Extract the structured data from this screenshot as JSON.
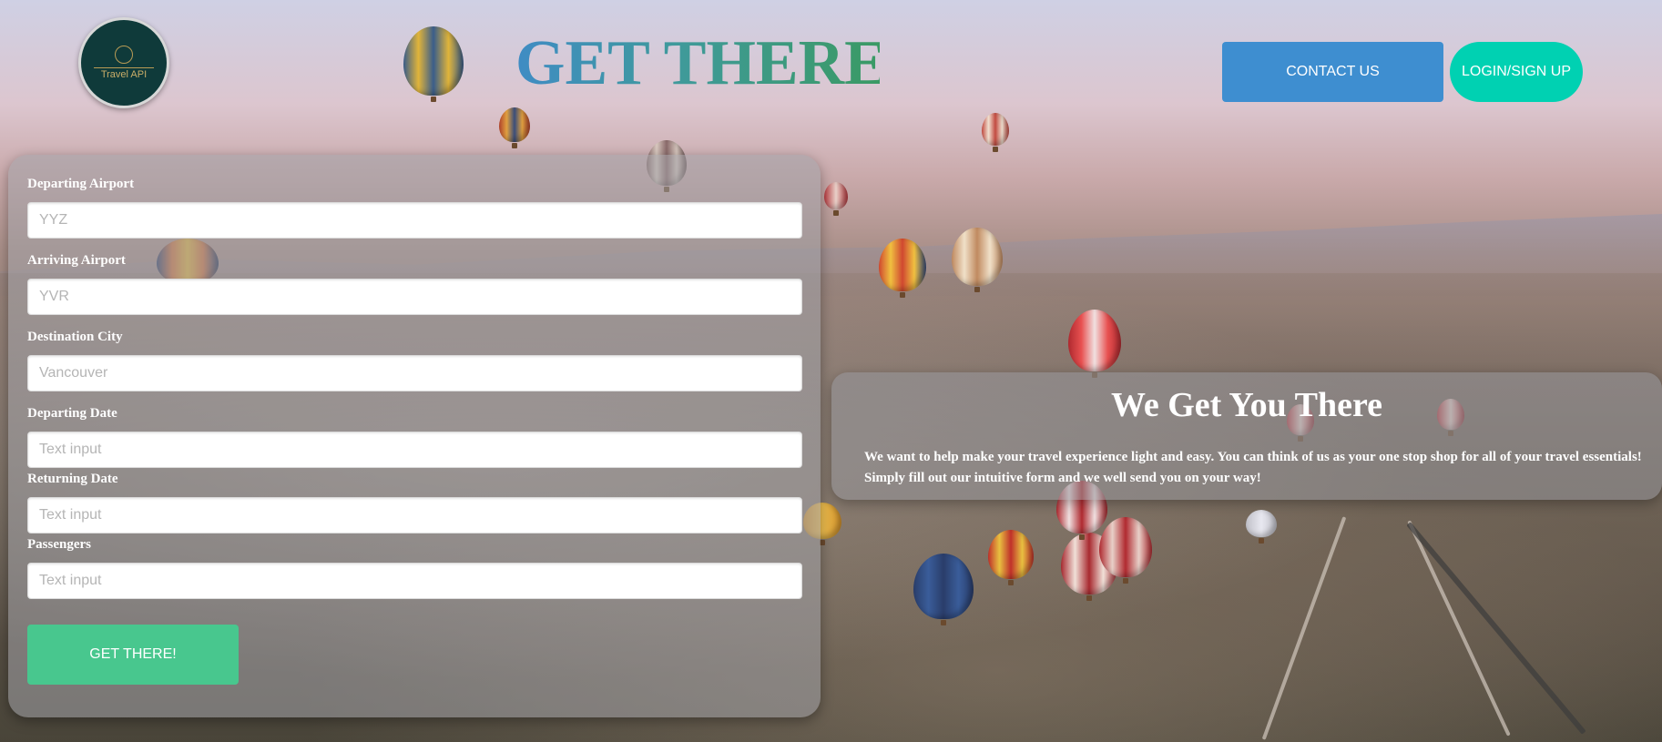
{
  "header": {
    "logo_text": "Travel API",
    "title": "GET THERE",
    "contact_label": "CONTACT US",
    "login_label": "LOGIN/SIGN UP"
  },
  "form": {
    "fields": [
      {
        "label": "Departing Airport",
        "placeholder": "YYZ"
      },
      {
        "label": "Arriving Airport",
        "placeholder": "YVR"
      },
      {
        "label": "Destination City",
        "placeholder": "Vancouver"
      },
      {
        "label": "Departing Date",
        "placeholder": "Text input"
      },
      {
        "label": "Returning Date",
        "placeholder": "Text input"
      },
      {
        "label": "Passengers",
        "placeholder": "Text input"
      }
    ],
    "submit_label": "GET THERE!"
  },
  "info": {
    "heading": "We Get You There",
    "body": "We want to help make your travel experience light and easy. You can think of us as your one stop shop for all of your travel essentials! Simply fill out our intuitive form and we well send you on your way!"
  },
  "colors": {
    "contact_button": "#3e8ed0",
    "login_button": "#00d1b2",
    "submit_button": "#48c78e",
    "logo_background": "#0f3a3a"
  }
}
